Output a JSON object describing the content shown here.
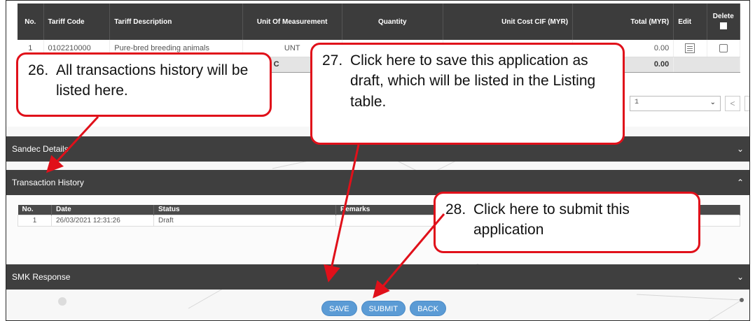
{
  "item_table": {
    "headers": [
      "No.",
      "Tariff Code",
      "Tariff Description",
      "Unit Of Measurement",
      "Quantity",
      "Unit Cost CIF (MYR)",
      "Total (MYR)",
      "Edit",
      "Delete"
    ],
    "row": {
      "no": "1",
      "tariff_code": "0102210000",
      "description": "Pure-bred breeding animals",
      "uom": "UNT",
      "total": "0.00"
    },
    "total_label": "TOTAL C",
    "total_value": "0.00"
  },
  "pagination": {
    "page": "1",
    "prev": "<",
    "next": ">"
  },
  "sections": {
    "sandec": "Sandec Details",
    "history": "Transaction History",
    "smk": "SMK Response"
  },
  "history_table": {
    "headers": [
      "No.",
      "Date",
      "Status",
      "Remarks"
    ],
    "row": {
      "no": "1",
      "date": "26/03/2021 12:31:26",
      "status": "Draft",
      "remarks": ""
    }
  },
  "buttons": {
    "save": "SAVE",
    "submit": "SUBMIT",
    "back": "BACK"
  },
  "callouts": {
    "c26": {
      "num": "26.",
      "text": "All transactions history will be listed here."
    },
    "c27": {
      "num": "27.",
      "text": "Click here to save this application as draft, which will be listed in the Listing table."
    },
    "c28": {
      "num": "28.",
      "text": "Click here to submit this application"
    }
  },
  "colors": {
    "callout_border": "#e0101a",
    "bar": "#3f3f3f",
    "button": "#5b9bd5"
  }
}
